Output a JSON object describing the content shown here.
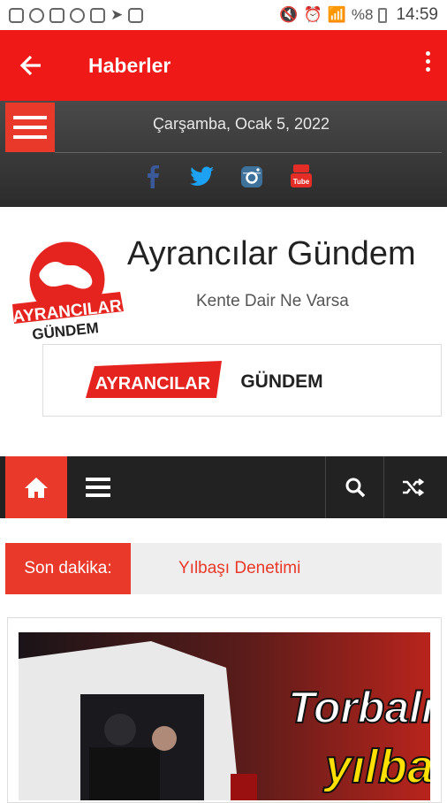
{
  "status_bar": {
    "battery_percent": "%8",
    "time": "14:59"
  },
  "app_bar": {
    "title": "Haberler"
  },
  "top_bar": {
    "date": "Çarşamba, Ocak 5, 2022",
    "social_icons": [
      "facebook-icon",
      "twitter-icon",
      "instagram-icon",
      "youtube-icon"
    ]
  },
  "header": {
    "site_title": "Ayrancılar Gündem",
    "tagline": "Kente Dair Ne Varsa",
    "logo_text_top": "AYRANCILAR",
    "logo_text_bottom": "GÜNDEM",
    "banner_left": "AYRANCILAR",
    "banner_right": "GÜNDEM"
  },
  "breaking": {
    "label": "Son dakika:",
    "headline": "Yılbaşı Denetimi"
  },
  "article": {
    "image_text_line1": "Torbalı",
    "image_text_line2": "yılba"
  },
  "colors": {
    "accent_red": "#ef1a17",
    "nav_dark": "#222222"
  }
}
